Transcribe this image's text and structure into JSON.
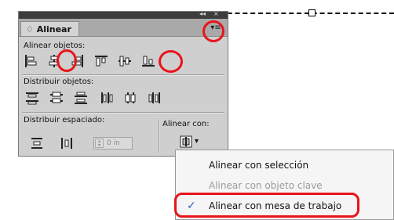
{
  "panel": {
    "tab_label": "♢ Alinear",
    "strip_collapse": "◂◂",
    "strip_close": "×",
    "menu_button": "▾≡",
    "sections": {
      "align_objects": "Alinear objetos:",
      "distribute_objects": "Distribuir objetos:",
      "distribute_spacing": "Distribuir espaciado:",
      "align_to": "Alinear con:"
    },
    "spacing_value": "0 in",
    "align_to_button": "▾"
  },
  "menu": {
    "items": [
      {
        "label": "Alinear con selección",
        "enabled": true,
        "checked": false
      },
      {
        "label": "Alinear con objeto clave",
        "enabled": false,
        "checked": false
      },
      {
        "label": "Alinear con mesa de trabajo",
        "enabled": true,
        "checked": true
      }
    ],
    "check_mark": "✓"
  },
  "icons": {
    "align_objects": [
      "align-left-icon",
      "align-horizontal-center-icon",
      "align-right-icon",
      "align-top-icon",
      "align-vertical-center-icon",
      "align-bottom-icon"
    ],
    "distribute_objects": [
      "distribute-top-icon",
      "distribute-vertical-center-icon",
      "distribute-bottom-icon",
      "distribute-left-icon",
      "distribute-horizontal-center-icon",
      "distribute-right-icon"
    ]
  },
  "colors": {
    "highlight_ring": "#e8141a",
    "check": "#2a5fb0",
    "panel_bg": "#cfcfcf"
  }
}
